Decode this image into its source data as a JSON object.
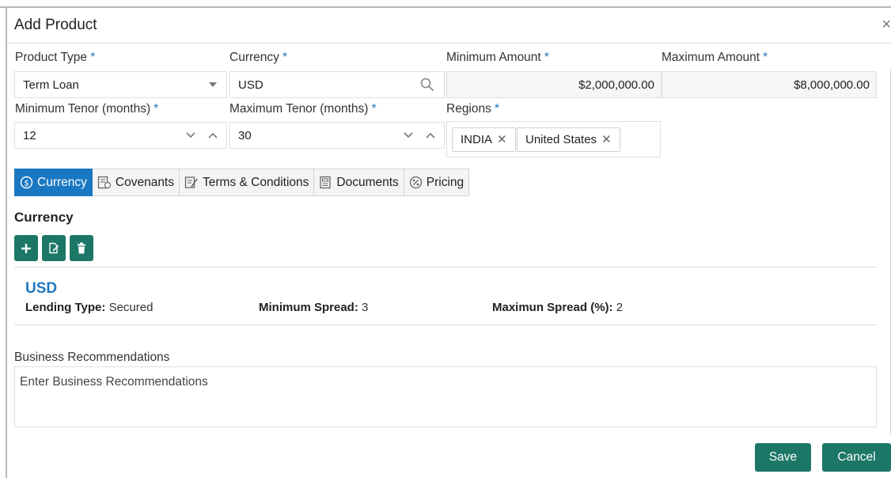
{
  "dialog": {
    "title": "Add Product",
    "close_label": "×"
  },
  "fields": {
    "product_type": {
      "label": "Product Type",
      "value": "Term Loan"
    },
    "currency": {
      "label": "Currency",
      "value": "USD"
    },
    "minimum_amount": {
      "label": "Minimum Amount",
      "value": "$2,000,000.00"
    },
    "maximum_amount": {
      "label": "Maximum Amount",
      "value": "$8,000,000.00"
    },
    "minimum_tenor": {
      "label": "Minimum Tenor (months)",
      "value": "12"
    },
    "maximum_tenor": {
      "label": "Maximum Tenor (months)",
      "value": "30"
    },
    "regions": {
      "label": "Regions",
      "tags": [
        "INDIA",
        "United States"
      ]
    },
    "required_mark": "*"
  },
  "tabs": [
    {
      "label": "Currency",
      "icon": "dollar-circle-icon",
      "active": true
    },
    {
      "label": "Covenants",
      "icon": "covenants-icon",
      "active": false
    },
    {
      "label": "Terms & Conditions",
      "icon": "terms-icon",
      "active": false
    },
    {
      "label": "Documents",
      "icon": "documents-icon",
      "active": false
    },
    {
      "label": "Pricing",
      "icon": "pricing-icon",
      "active": false
    }
  ],
  "currency_section": {
    "title": "Currency",
    "actions": [
      "add-icon",
      "edit-icon",
      "delete-icon"
    ],
    "record": {
      "code": "USD",
      "lending_type_label": "Lending Type:",
      "lending_type_value": "Secured",
      "min_spread_label": "Minimum Spread:",
      "min_spread_value": "3",
      "max_spread_label": "Maximun Spread (%):",
      "max_spread_value": "2"
    }
  },
  "business_recommendations": {
    "label": "Business Recommendations",
    "placeholder": "Enter Business Recommendations"
  },
  "footer": {
    "save_label": "Save",
    "cancel_label": "Cancel"
  },
  "colors": {
    "accent": "#1a78c2",
    "button": "#1d7766",
    "required": "#1f79c2"
  }
}
